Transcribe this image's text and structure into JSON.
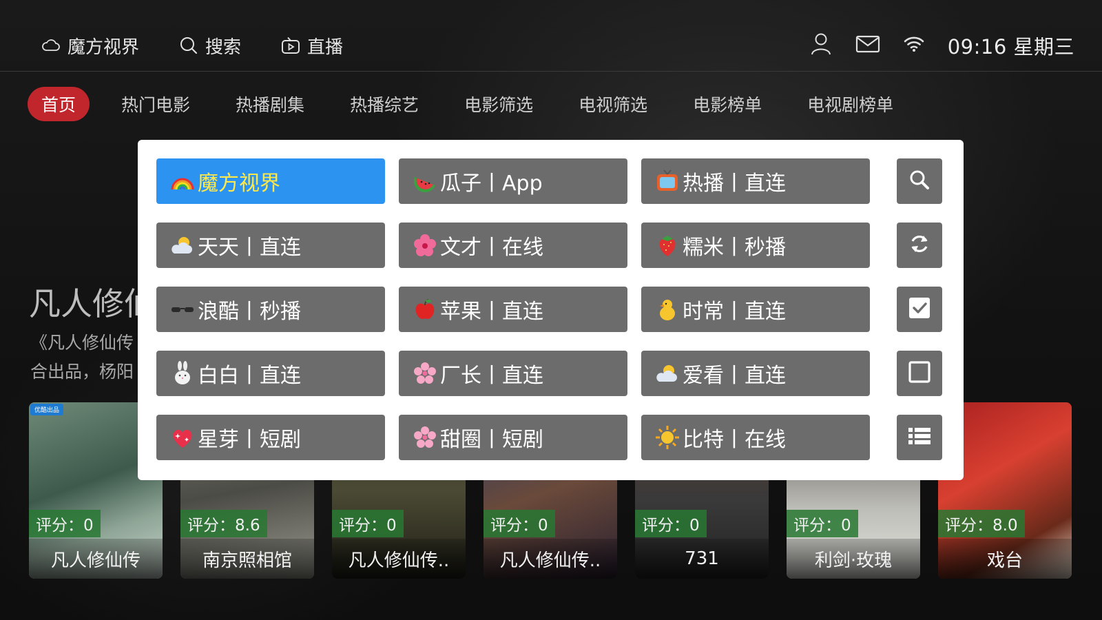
{
  "topbar": {
    "app_label": "魔方视界",
    "search_label": "搜索",
    "live_label": "直播",
    "clock": "09:16 星期三"
  },
  "nav": {
    "tabs": [
      {
        "label": "首页",
        "active": true
      },
      {
        "label": "热门电影"
      },
      {
        "label": "热播剧集"
      },
      {
        "label": "热播综艺"
      },
      {
        "label": "电影筛选"
      },
      {
        "label": "电视筛选"
      },
      {
        "label": "电影榜单"
      },
      {
        "label": "电视剧榜单"
      }
    ]
  },
  "hero": {
    "title": "凡人修仙传",
    "desc_line1": "《凡人修仙传",
    "desc_line2": "合出品，杨阳"
  },
  "posters": [
    {
      "title": "凡人修仙传",
      "rating": "评分：0",
      "badge": "优酷出品"
    },
    {
      "title": "南京照相馆",
      "rating": "评分：8.6"
    },
    {
      "title": "凡人修仙传..",
      "rating": "评分：0"
    },
    {
      "title": "凡人修仙传..",
      "rating": "评分：0"
    },
    {
      "title": "731",
      "rating": "评分：0"
    },
    {
      "title": "利剑·玫瑰",
      "rating": "评分：0"
    },
    {
      "title": "戏台",
      "rating": "评分：8.0"
    }
  ],
  "source_popup": {
    "selected_index": 0,
    "sources": [
      {
        "label": "魔方视界",
        "icon": "rainbow-icon"
      },
      {
        "label": "瓜子丨App",
        "icon": "watermelon-icon"
      },
      {
        "label": "热播丨直连",
        "icon": "tv-icon"
      },
      {
        "label": "天天丨直连",
        "icon": "sun-cloud-icon"
      },
      {
        "label": "文才丨在线",
        "icon": "hibiscus-icon"
      },
      {
        "label": "糯米丨秒播",
        "icon": "strawberry-icon"
      },
      {
        "label": "浪酷丨秒播",
        "icon": "glasses-icon"
      },
      {
        "label": "苹果丨直连",
        "icon": "apple-icon"
      },
      {
        "label": "时常丨直连",
        "icon": "chick-icon"
      },
      {
        "label": "白白丨直连",
        "icon": "rabbit-icon"
      },
      {
        "label": "厂长丨直连",
        "icon": "cherry-blossom-icon"
      },
      {
        "label": "爱看丨直连",
        "icon": "sun-cloud-icon"
      },
      {
        "label": "星芽丨短剧",
        "icon": "sparkling-heart-icon"
      },
      {
        "label": "甜圈丨短剧",
        "icon": "cherry-blossom-icon"
      },
      {
        "label": "比特丨在线",
        "icon": "sun-icon"
      }
    ],
    "side_buttons": [
      "search-icon",
      "refresh-icon",
      "checked-box-icon",
      "empty-box-icon",
      "list-icon"
    ]
  },
  "colors": {
    "accent_red": "#c0262c",
    "selected_blue": "#2c94f0",
    "selected_text_yellow": "#ffe94a",
    "button_gray": "#6c6c6c",
    "rating_green": "#287832"
  }
}
